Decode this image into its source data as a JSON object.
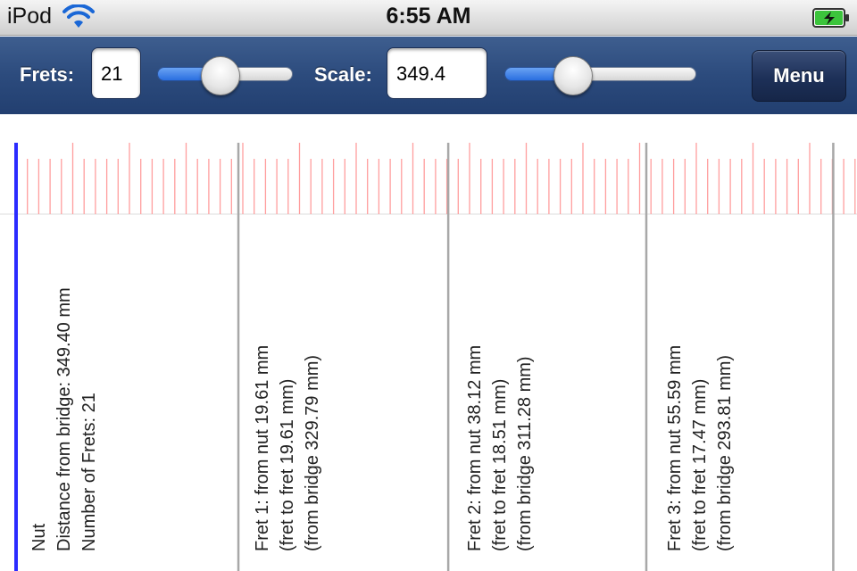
{
  "status_bar": {
    "carrier": "iPod",
    "time": "6:55 AM"
  },
  "toolbar": {
    "frets_label": "Frets:",
    "frets_value": "21",
    "frets_slider_fraction": 0.45,
    "scale_label": "Scale:",
    "scale_value": "349.4",
    "scale_slider_fraction": 0.32,
    "menu_label": "Menu"
  },
  "colors": {
    "nut_line": "#2b2bff",
    "fret_line": "#a8a8a8",
    "ruler_tick": "#ff9e9e",
    "toolbar": "#2c4b7d"
  },
  "nut": {
    "line1": "Nut",
    "line2": "Distance from bridge: 349.40 mm",
    "line3": "Number of Frets: 21"
  },
  "frets": [
    {
      "line1": "Fret 1: from nut 19.61 mm",
      "line2": "(fret to fret 19.61 mm)",
      "line3": "(from bridge 329.79 mm)"
    },
    {
      "line1": "Fret 2: from nut 38.12 mm",
      "line2": "(fret to fret 18.51 mm)",
      "line3": "(from bridge 311.28 mm)"
    },
    {
      "line1": "Fret 3: from nut 55.59 mm",
      "line2": "(fret to fret 17.47 mm)",
      "line3": "(from bridge 293.81 mm)"
    }
  ]
}
